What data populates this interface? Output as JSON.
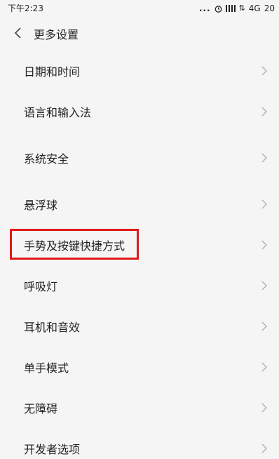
{
  "status_bar": {
    "time": "下午2:23",
    "dots": "...",
    "network": "4G",
    "battery": "20",
    "icons": [
      "alarm-icon",
      "signal-icon",
      "data-arrows-icon"
    ]
  },
  "header": {
    "back_icon": "back-chevron-icon",
    "title": "更多设置"
  },
  "items": [
    {
      "label": "日期和时间"
    },
    {
      "label": "语言和输入法"
    },
    {
      "label": "系统安全"
    },
    {
      "label": "悬浮球"
    },
    {
      "label": "手势及按键快捷方式",
      "highlighted": true
    },
    {
      "label": "呼吸灯"
    },
    {
      "label": "耳机和音效"
    },
    {
      "label": "单手模式"
    },
    {
      "label": "无障碍"
    },
    {
      "label": "开发者选项"
    }
  ],
  "colors": {
    "background": "#f5f5f5",
    "text": "#222222",
    "chevron": "#b0b0b0",
    "highlight_border": "#e01818"
  }
}
